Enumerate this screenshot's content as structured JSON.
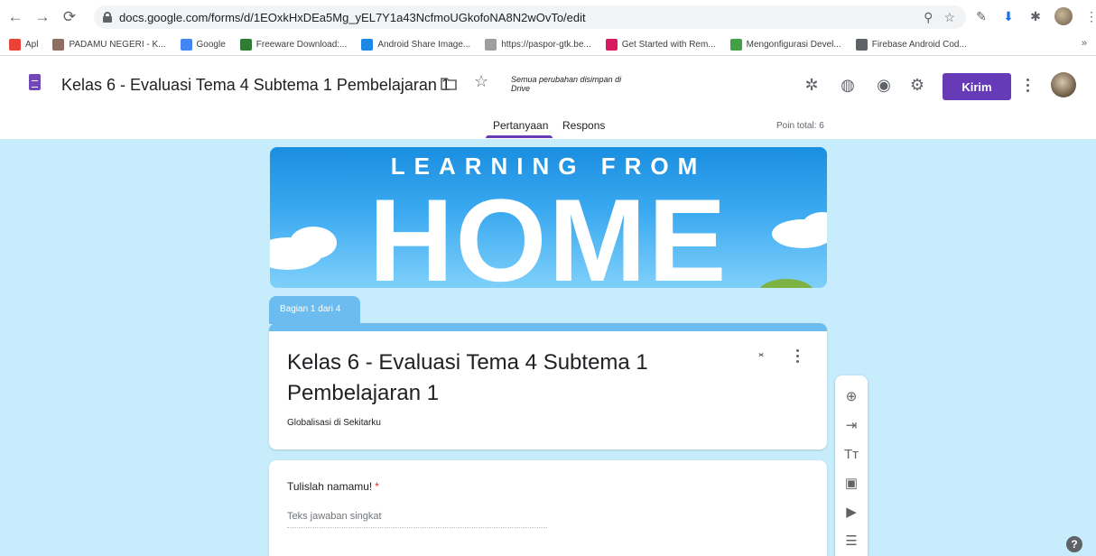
{
  "browser": {
    "url": "docs.google.com/forms/d/1EOxkHxDEa5Mg_yEL7Y1a43NcfmoUGkofoNA8N2wOvTo/edit",
    "bookmarks": [
      {
        "label": "Apl",
        "icon": "apps-grid-icon",
        "color": "#ea4335"
      },
      {
        "label": "PADAMU NEGERI - K...",
        "icon": "garuda-icon",
        "color": "#8d6e63"
      },
      {
        "label": "Google",
        "icon": "google-g-icon",
        "color": "#4285f4"
      },
      {
        "label": "Freeware Download:...",
        "icon": "palm-tree-icon",
        "color": "#2e7d32"
      },
      {
        "label": "Android Share Image...",
        "icon": "android-share-icon",
        "color": "#1e88e5"
      },
      {
        "label": "https://paspor-gtk.be...",
        "icon": "page-icon",
        "color": "#9e9e9e"
      },
      {
        "label": "Get Started with Rem...",
        "icon": "code-brackets-icon",
        "color": "#d81b60"
      },
      {
        "label": "Mengonfigurasi Devel...",
        "icon": "android-icon",
        "color": "#43a047"
      },
      {
        "label": "Firebase Android Cod...",
        "icon": "code-icon",
        "color": "#5f6368"
      }
    ],
    "more": "»"
  },
  "header": {
    "title": "Kelas 6 - Evaluasi Tema 4 Subtema 1 Pembelajaran 1",
    "saved_note": "Semua perubahan disimpan di Drive",
    "send_label": "Kirim",
    "accent": "#673ab7"
  },
  "tabs": {
    "questions": "Pertanyaan",
    "responses": "Respons",
    "points": "Poin total: 6"
  },
  "banner": {
    "top_text": "LEARNING FROM",
    "main_text": "HOME"
  },
  "section": {
    "label": "Bagian 1 dari 4",
    "color": "#6cbcef"
  },
  "form": {
    "title": "Kelas 6 - Evaluasi Tema 4 Subtema 1 Pembelajaran 1",
    "description": "Globalisasi di Sekitarku"
  },
  "question": {
    "label": "Tulislah namamu!",
    "required_mark": "*",
    "answer_placeholder": "Teks jawaban singkat"
  },
  "toolbar": [
    {
      "icon": "add-circle-icon",
      "glyph": "⊕"
    },
    {
      "icon": "import-question-icon",
      "glyph": "⇥"
    },
    {
      "icon": "title-text-icon",
      "glyph": "Tт"
    },
    {
      "icon": "image-icon",
      "glyph": "▣"
    },
    {
      "icon": "video-icon",
      "glyph": "▶"
    },
    {
      "icon": "section-icon",
      "glyph": "☰"
    }
  ],
  "help_glyph": "?",
  "background": "#c7ecfc"
}
